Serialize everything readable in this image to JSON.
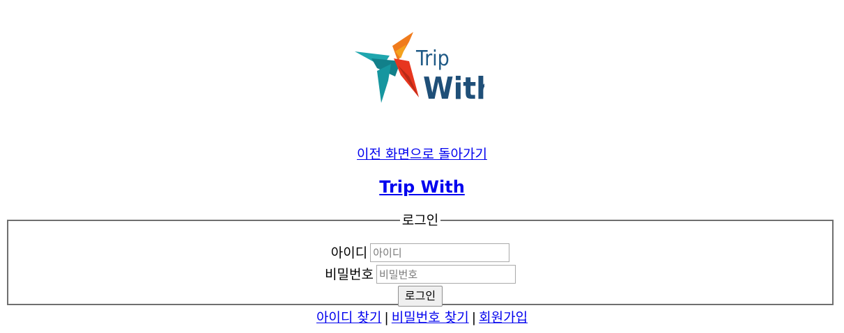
{
  "logo": {
    "line1": "Trip",
    "line2": "With"
  },
  "back_link": "이전 화면으로 돌아가기",
  "site_title": "Trip With",
  "login": {
    "legend": "로그인",
    "id_label": "아이디",
    "id_placeholder": "아이디",
    "pw_label": "비밀번호",
    "pw_placeholder": "비밀번호",
    "submit_label": "로그인"
  },
  "footer_links": {
    "find_id": "아이디 찾기",
    "find_pw": "비밀번호 찾기",
    "signup": "회원가입",
    "separator": "|"
  },
  "colors": {
    "link": "#0000ee",
    "logo_text": "#1f5a86",
    "logo_teal": "#1fa6ae",
    "logo_orange": "#f07b1c",
    "logo_red": "#e7361f"
  }
}
